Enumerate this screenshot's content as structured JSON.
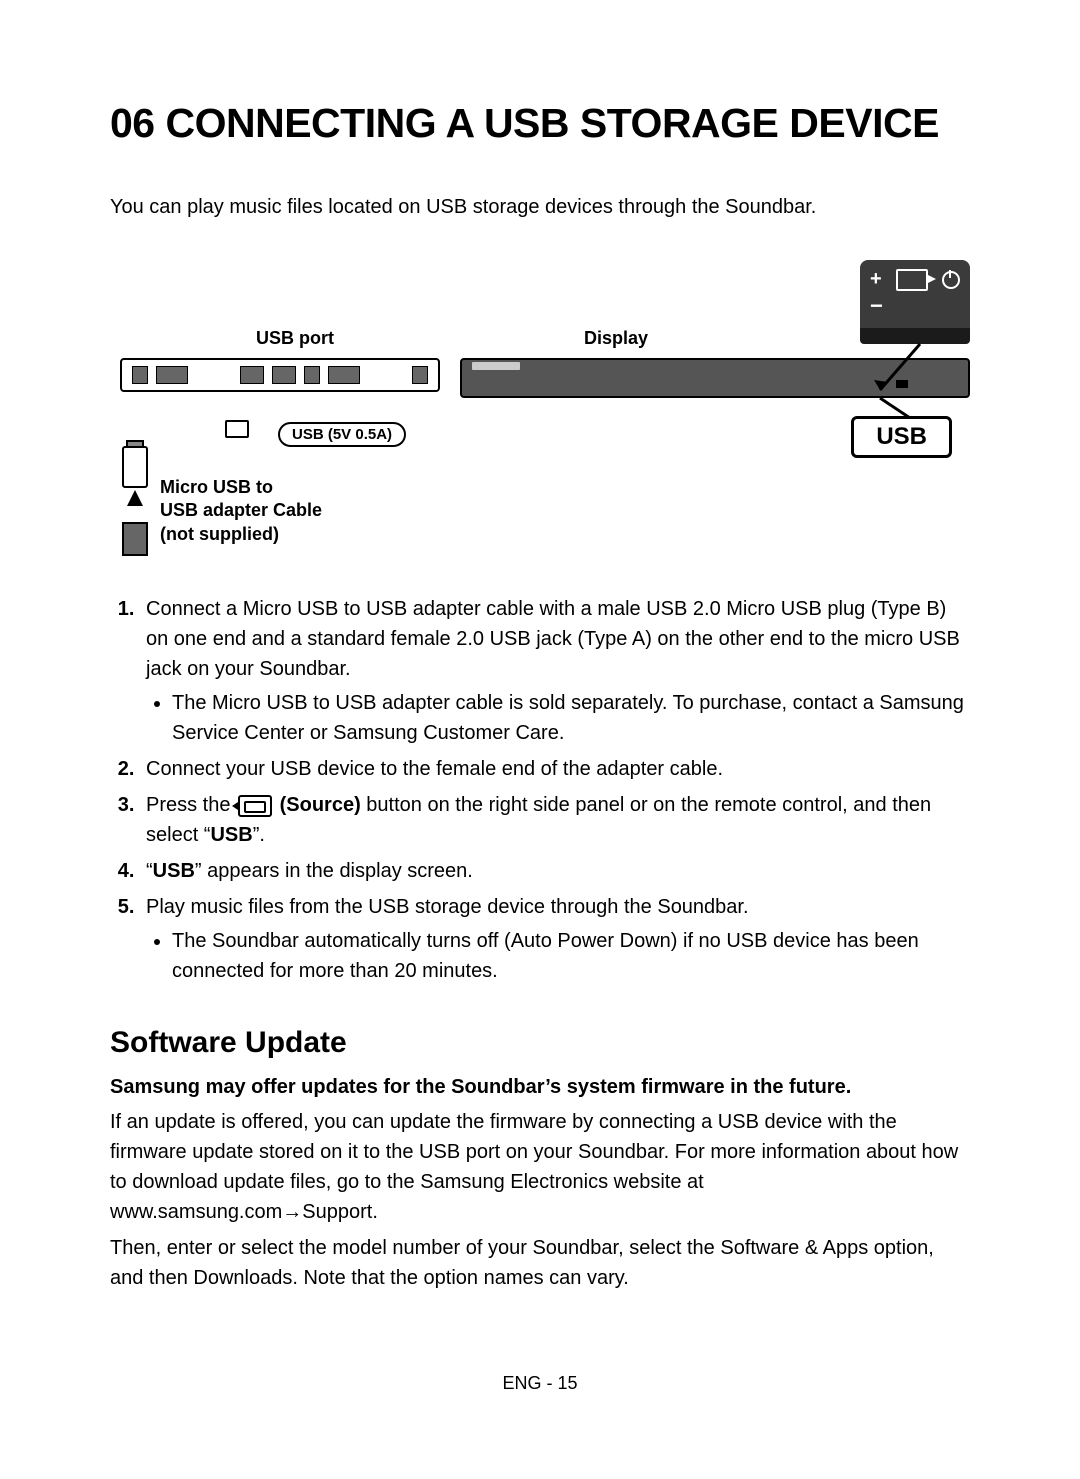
{
  "title": "06  CONNECTING A USB STORAGE DEVICE",
  "intro": "You can play music files located on USB storage devices through the Soundbar.",
  "diagram": {
    "usb_port_label": "USB port",
    "display_label": "Display",
    "usb_spec_label": "USB (5V 0.5A)",
    "cable_label_l1": "Micro USB to",
    "cable_label_l2": "USB adapter Cable",
    "cable_label_l3": "(not supplied)",
    "usb_box": "USB",
    "control_plus": "+",
    "control_minus": "−"
  },
  "steps": {
    "s1": "Connect a Micro USB to USB adapter cable with a male USB 2.0 Micro USB plug (Type B) on one end and a standard female 2.0 USB jack (Type A) on the other end to the micro USB jack on your Soundbar.",
    "s1_sub1": "The Micro USB to USB adapter cable is sold separately. To purchase, contact a Samsung Service Center or Samsung Customer Care.",
    "s2": "Connect your USB device to the female end of the adapter cable.",
    "s3_a": "Press the ",
    "s3_source": " (Source)",
    "s3_b": " button on the right side panel or on the remote control, and then select “",
    "s3_usb": "USB",
    "s3_c": "”.",
    "s4_a": "“",
    "s4_usb": "USB",
    "s4_b": "” appears in the display screen.",
    "s5": "Play music files from the USB storage device through the Soundbar.",
    "s5_sub1": "The Soundbar automatically turns off (Auto Power Down) if no USB device has been connected for more than 20 minutes."
  },
  "software": {
    "heading": "Software Update",
    "bold": "Samsung may offer updates for the Soundbar’s system firmware in the future.",
    "p1": "If an update is offered, you can update the firmware by connecting a USB device with the firmware update stored on it to the USB port on your Soundbar. For more information about how to download update files, go to the Samsung Electronics website at www.samsung.com→Support.",
    "p2": "Then, enter or select the model number of your Soundbar, select the Software & Apps option, and then Downloads. Note that the option names can vary."
  },
  "footer": "ENG - 15"
}
